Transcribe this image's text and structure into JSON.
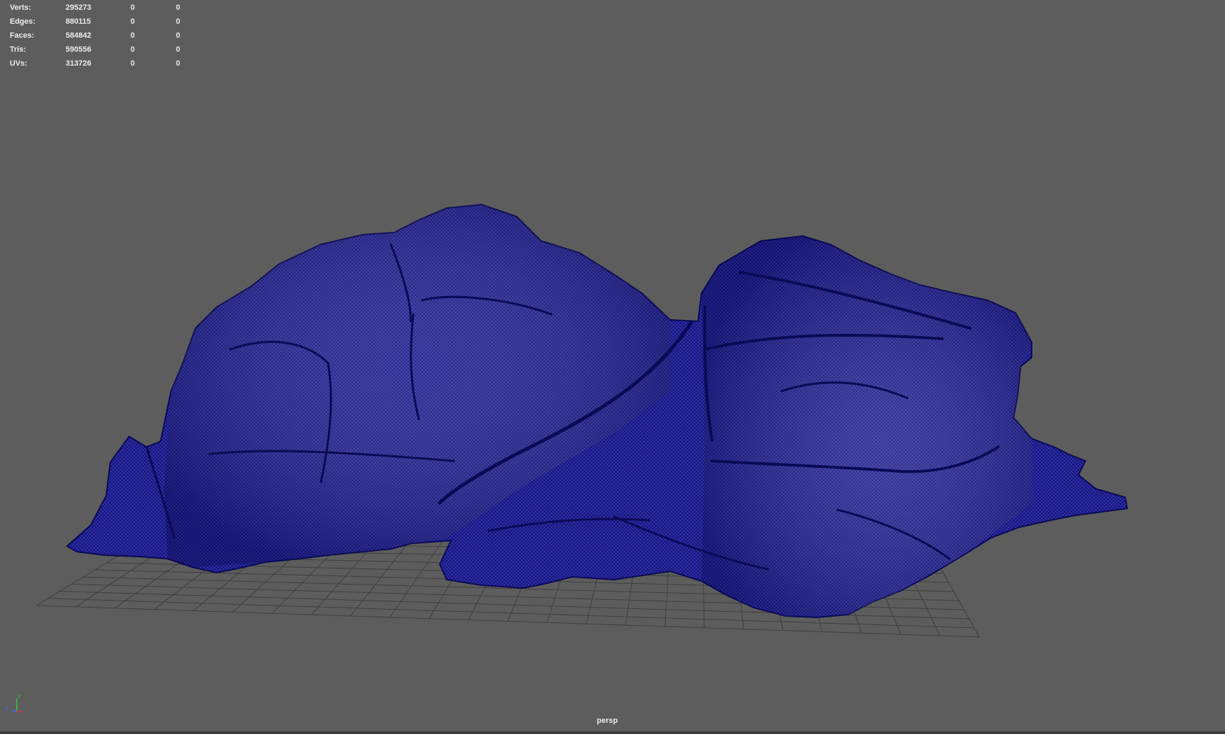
{
  "hud": {
    "rows": [
      {
        "label": "Verts:",
        "v1": "295273",
        "v2": "0",
        "v3": "0"
      },
      {
        "label": "Edges:",
        "v1": "880115",
        "v2": "0",
        "v3": "0"
      },
      {
        "label": "Faces:",
        "v1": "584842",
        "v2": "0",
        "v3": "0"
      },
      {
        "label": "Tris:",
        "v1": "590556",
        "v2": "0",
        "v3": "0"
      },
      {
        "label": "UVs:",
        "v1": "313726",
        "v2": "0",
        "v3": "0"
      }
    ]
  },
  "viewport": {
    "camera_name": "persp",
    "background_color": "#5d5d5d",
    "wireframe_color": "#13137a",
    "grid_color": "#3e3e3e"
  },
  "axis_gizmo": {
    "y_label": "Y",
    "z_label": "Z"
  }
}
